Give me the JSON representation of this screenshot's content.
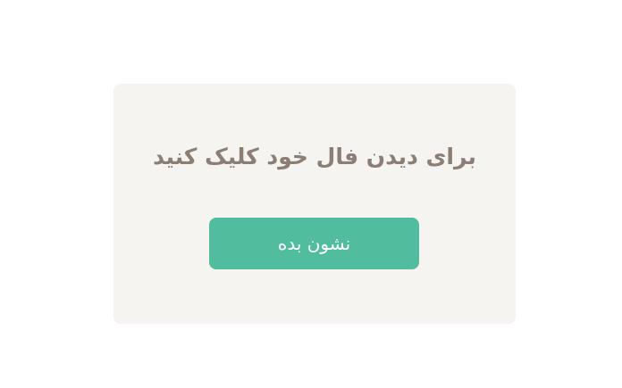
{
  "card": {
    "title": "برای دیدن فال خود کلیک کنید",
    "button_label": "نشون بده"
  },
  "colors": {
    "page_background": "#ffffff",
    "card_background": "#f6f4f1",
    "title_text": "#8a7e75",
    "button_background": "#52bd9e",
    "button_text": "#ffffff"
  }
}
